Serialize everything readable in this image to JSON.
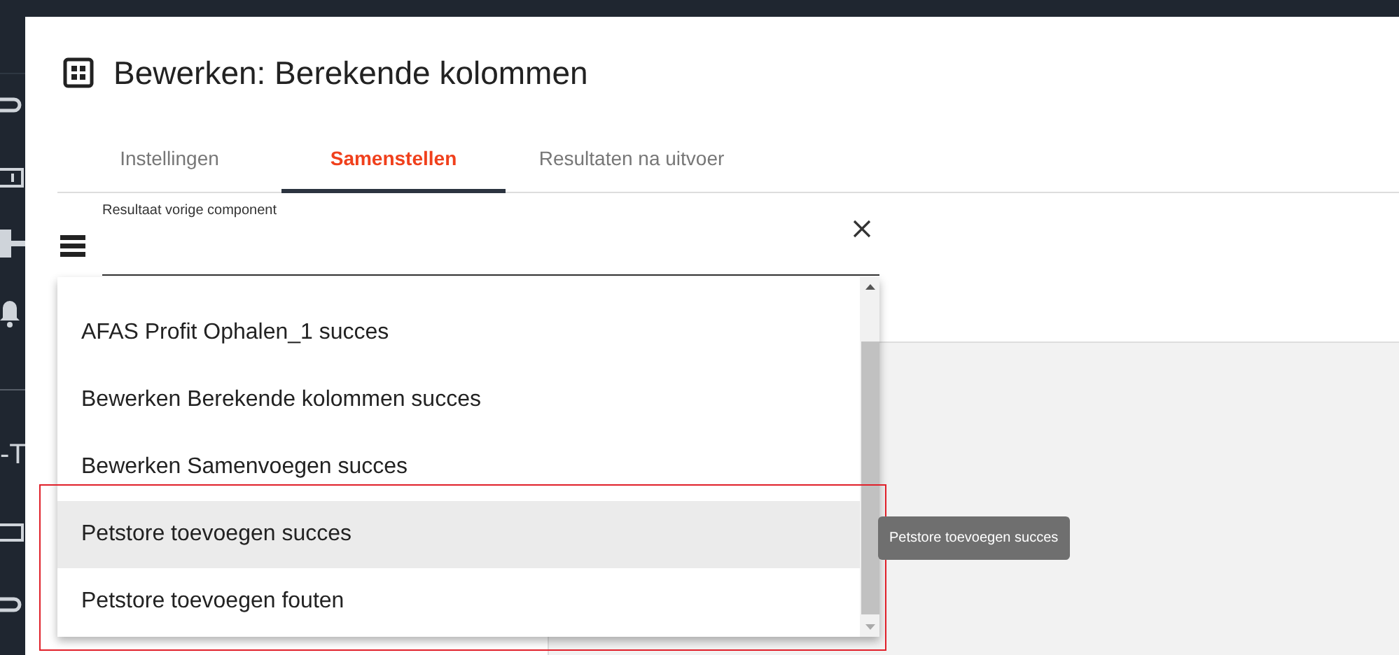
{
  "sidebar": {
    "fragment": "-T"
  },
  "dialog": {
    "title": "Bewerken: Berekende kolommen"
  },
  "tabs": [
    {
      "label": "Instellingen",
      "selected": false
    },
    {
      "label": "Samenstellen",
      "selected": true
    },
    {
      "label": "Resultaten na uitvoer",
      "selected": false
    }
  ],
  "field": {
    "label": "Resultaat vorige component"
  },
  "dropdown": {
    "items": [
      {
        "label": "AFAS Profit Ophalen_1 succes",
        "selected": false
      },
      {
        "label": "Bewerken Berekende kolommen succes",
        "selected": false
      },
      {
        "label": "Bewerken Samenvoegen succes",
        "selected": false
      },
      {
        "label": "Petstore toevoegen succes",
        "selected": true
      },
      {
        "label": "Petstore toevoegen fouten",
        "selected": false
      }
    ]
  },
  "tooltip": "Petstore toevoegen succes"
}
